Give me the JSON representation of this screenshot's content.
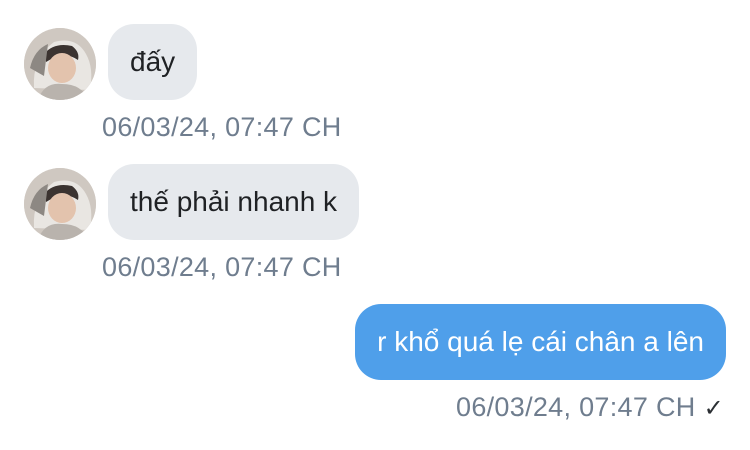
{
  "messages": [
    {
      "direction": "incoming",
      "text": "đấy",
      "timestamp": "06/03/24, 07:47 CH",
      "avatar": "user-avatar-icon"
    },
    {
      "direction": "incoming",
      "text": "thế phải nhanh k",
      "timestamp": "06/03/24, 07:47 CH",
      "avatar": "user-avatar-icon"
    },
    {
      "direction": "outgoing",
      "text": "r khổ quá lẹ cái chân a lên",
      "timestamp": "06/03/24, 07:47 CH",
      "status_icon": "checkmark-icon",
      "status_glyph": "✓"
    }
  ],
  "colors": {
    "incoming_bubble": "#e6e9ed",
    "outgoing_bubble": "#4f9fea",
    "timestamp": "#6f7d8e"
  }
}
